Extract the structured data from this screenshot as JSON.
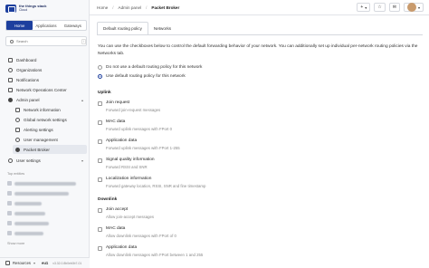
{
  "brand": {
    "name": "the things stack",
    "edition": "Cloud"
  },
  "sidebar": {
    "switcher": [
      "Home",
      "Applications",
      "Gateways"
    ],
    "search_placeholder": "Search",
    "search_shortcut": "/",
    "nav": [
      {
        "label": "Dashboard"
      },
      {
        "label": "Organizations"
      },
      {
        "label": "Notifications"
      },
      {
        "label": "Network Operations Center"
      },
      {
        "label": "Admin panel"
      }
    ],
    "admin_sub": [
      {
        "label": "Network information"
      },
      {
        "label": "Global network settings"
      },
      {
        "label": "Alerting settings"
      },
      {
        "label": "User management"
      },
      {
        "label": "Packet Broker"
      }
    ],
    "user_settings": "User settings",
    "top_entities_label": "Top entities",
    "show_more": "Show more",
    "footer": {
      "resources": "Resources",
      "cluster": "eu1",
      "version": "v3.32.0.8b0eb0b7-01"
    }
  },
  "breadcrumb": [
    "Home",
    "Admin panel",
    "Packet Broker"
  ],
  "topbar": {
    "add_label": "+"
  },
  "tabs": [
    "Default routing policy",
    "Networks"
  ],
  "intro": "You can use the checkboxes below to control the default forwarding behavior of your network. You can additionally set up individual per-network routing policies via the Networks tab.",
  "policy_options": [
    {
      "label": "Do not use a default routing policy for this network",
      "selected": false
    },
    {
      "label": "Use default routing policy for this network",
      "selected": true
    }
  ],
  "uplink": {
    "title": "Uplink",
    "items": [
      {
        "label": "Join request",
        "desc": "Forward join-request messages"
      },
      {
        "label": "MAC data",
        "desc": "Forward uplink messages with FPort 0"
      },
      {
        "label": "Application data",
        "desc": "Forward uplink messages with FPort 1-255"
      },
      {
        "label": "Signal quality information",
        "desc": "Forward RSSI and SNR"
      },
      {
        "label": "Localization information",
        "desc": "Forward gateway location, RSSI, SNR and fine timestamp"
      }
    ]
  },
  "downlink": {
    "title": "Downlink",
    "items": [
      {
        "label": "Join accept",
        "desc": "Allow join-accept messages"
      },
      {
        "label": "MAC data",
        "desc": "Allow downlink messages with FPort of 0"
      },
      {
        "label": "Application data",
        "desc": "Allow downlink messages with FPort between 1 and 255"
      }
    ]
  }
}
